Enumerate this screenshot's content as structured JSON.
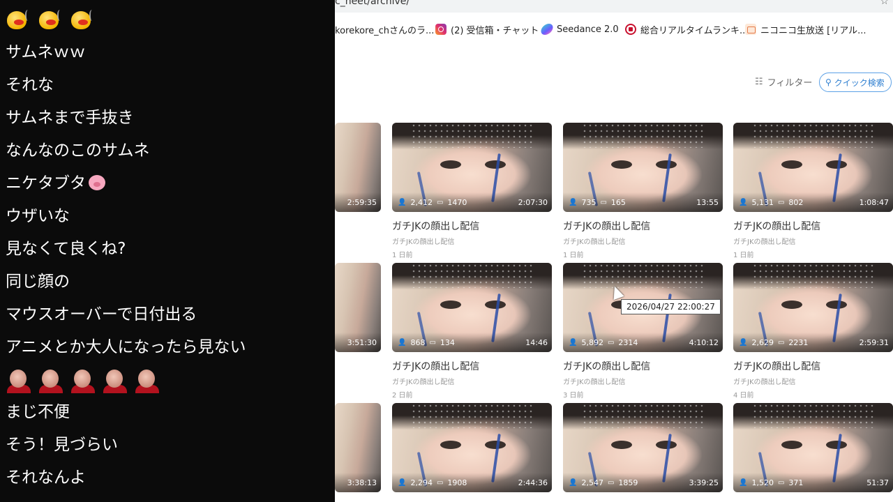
{
  "chat": {
    "messages": [
      "サムネｗｗ",
      "それな",
      "サムネまで手抜き",
      "なんなのこのサムネ",
      "ニケタブタ",
      "ウザいな",
      "見なくて良くね?",
      "同じ顔の",
      "マウスオーバーで日付出る",
      "アニメとか大人になったら見ない",
      "まじ不便",
      "そう！見づらい",
      "それなんよ"
    ]
  },
  "browser": {
    "url": "c_heet/archive/",
    "bookmarks": [
      {
        "label": "korekore_chさんのラ...",
        "icon": "none"
      },
      {
        "label": "(2) 受信箱・チャット",
        "icon": "instagram-icon"
      },
      {
        "label": "Seedance 2.0",
        "icon": "seedance-icon"
      },
      {
        "label": "総合リアルタイムランキ...",
        "icon": "ranking-icon"
      },
      {
        "label": "ニコニコ生放送 [リアル...",
        "icon": "niconico-icon"
      }
    ],
    "filter_label": "フィルター",
    "quick_search_label": "クイック検索",
    "tooltip": "2026/04/27 22:00:27"
  },
  "videos": {
    "partial": [
      {
        "duration": "2:59:35"
      },
      {
        "duration": "3:51:30"
      },
      {
        "duration": "3:38:13"
      }
    ],
    "rows": [
      [
        {
          "views": "2,412",
          "comments": "1470",
          "duration": "2:07:30",
          "title": "ガチJKの顔出し配信",
          "sub": "ガチJKの顔出し配信",
          "date": "1 日前"
        },
        {
          "views": "735",
          "comments": "165",
          "duration": "13:55",
          "title": "ガチJKの顔出し配信",
          "sub": "ガチJKの顔出し配信",
          "date": "1 日前"
        },
        {
          "views": "5,131",
          "comments": "802",
          "duration": "1:08:47",
          "title": "ガチJKの顔出し配信",
          "sub": "ガチJKの顔出し配信",
          "date": "1 日前"
        }
      ],
      [
        {
          "views": "868",
          "comments": "134",
          "duration": "14:46",
          "title": "ガチJKの顔出し配信",
          "sub": "ガチJKの顔出し配信",
          "date": "2 日前"
        },
        {
          "views": "5,892",
          "comments": "2314",
          "duration": "4:10:12",
          "title": "ガチJKの顔出し配信",
          "sub": "ガチJKの顔出し配信",
          "date": "3 日前"
        },
        {
          "views": "2,629",
          "comments": "2231",
          "duration": "2:59:31",
          "title": "ガチJKの顔出し配信",
          "sub": "ガチJKの顔出し配信",
          "date": "4 日前"
        }
      ],
      [
        {
          "views": "2,294",
          "comments": "1908",
          "duration": "2:44:36"
        },
        {
          "views": "2,547",
          "comments": "1859",
          "duration": "3:39:25"
        },
        {
          "views": "1,520",
          "comments": "371",
          "duration": "51:37"
        }
      ]
    ]
  }
}
